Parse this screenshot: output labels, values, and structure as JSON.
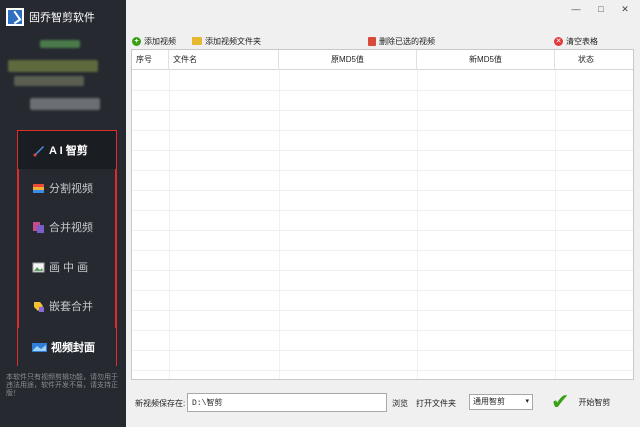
{
  "app": {
    "title": "固乔智剪软件"
  },
  "window": {
    "minimize": "—",
    "maximize": "□",
    "close": "✕"
  },
  "sidebar": {
    "nav": [
      {
        "label": "A I 智剪",
        "icon": "brush-icon",
        "active": true
      },
      {
        "label": "分割视频",
        "icon": "split-video-icon",
        "active": false
      },
      {
        "label": "合并视频",
        "icon": "merge-video-icon",
        "active": false
      },
      {
        "label": "画 中 画",
        "icon": "picture-in-picture-icon",
        "active": false
      },
      {
        "label": "嵌套合并",
        "icon": "nested-merge-icon",
        "active": false
      },
      {
        "label": "视频封面",
        "icon": "video-cover-icon",
        "active": false
      }
    ],
    "notice": "本软件只有视频剪辑功能，请勿用于违法用途，软件开发不易，请支持正版！"
  },
  "toolbar": {
    "add_video": "添加视频",
    "add_folder": "添加视频文件夹",
    "delete_selected": "删除已选的视频",
    "clear_table": "清空表格"
  },
  "table": {
    "columns": [
      "序号",
      "文件名",
      "原MD5值",
      "新MD5值",
      "状态"
    ],
    "rows": []
  },
  "footer": {
    "save_label": "新视频保存在:",
    "save_path": "D:\\智剪",
    "browse": "浏览",
    "open_folder": "打开文件夹",
    "mode": "通用智剪",
    "start": "开始智剪"
  },
  "colors": {
    "sidebar_bg": "#262a30",
    "highlight_border": "#e02b2b",
    "start_check": "#3aa017"
  }
}
